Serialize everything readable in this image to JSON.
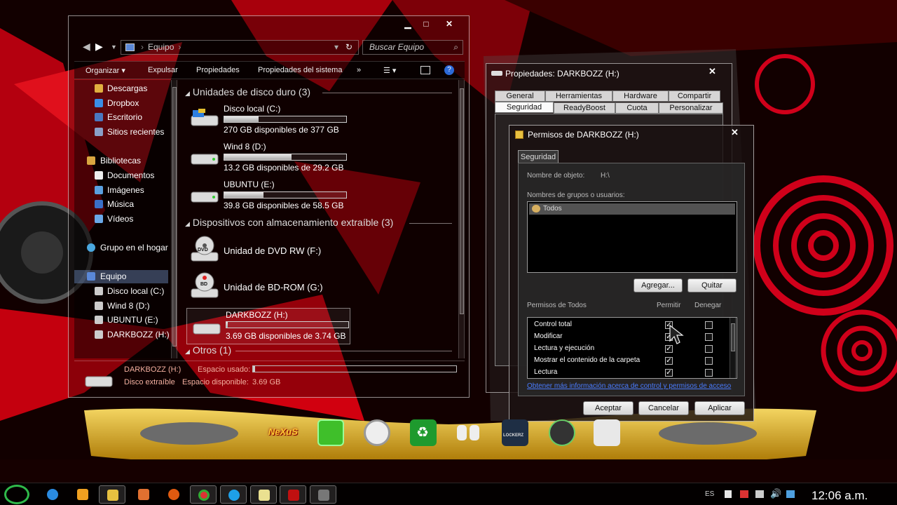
{
  "explorer": {
    "address_text": "Equipo",
    "search_placeholder": "Buscar Equipo",
    "toolbar": {
      "organize": "Organizar",
      "eject": "Expulsar",
      "properties": "Propiedades",
      "system_properties": "Propiedades del sistema",
      "more": "»"
    },
    "nav": {
      "favorites": [
        "Descargas",
        "Dropbox",
        "Escritorio",
        "Sitios recientes"
      ],
      "libraries_header": "Bibliotecas",
      "libraries": [
        "Documentos",
        "Imágenes",
        "Música",
        "Vídeos"
      ],
      "homegroup": "Grupo en el hogar",
      "computer": "Equipo",
      "drives": [
        "Disco local (C:)",
        "Wind 8 (D:)",
        "UBUNTU (E:)",
        "DARKBOZZ (H:)"
      ]
    },
    "groups": {
      "hard_disks": "Unidades de disco duro (3)",
      "removable": "Dispositivos con almacenamiento extraíble (3)",
      "other": "Otros (1)"
    },
    "hard_disks": [
      {
        "name": "Disco local (C:)",
        "free": "270 GB disponibles de 377 GB",
        "used_fraction": 0.28
      },
      {
        "name": "Wind 8 (D:)",
        "free": "13.2 GB disponibles de 29.2 GB",
        "used_fraction": 0.55
      },
      {
        "name": "UBUNTU (E:)",
        "free": "39.8 GB disponibles de 58.5 GB",
        "used_fraction": 0.32
      }
    ],
    "removable": [
      {
        "name": "Unidad de DVD RW (F:)",
        "icon_text": "DVD"
      },
      {
        "name": "Unidad de BD-ROM (G:)",
        "icon_text": "BD"
      },
      {
        "name": "DARKBOZZ (H:)",
        "free": "3.69 GB disponibles de 3.74 GB",
        "used_fraction": 0.01
      }
    ],
    "details": {
      "name": "DARKBOZZ (H:)",
      "type": "Disco extraíble",
      "used_label": "Espacio usado:",
      "free_label": "Espacio disponible:",
      "free_value": "3.69 GB"
    }
  },
  "properties": {
    "title": "Propiedades: DARKBOZZ (H:)",
    "tabs_row1": [
      "General",
      "Herramientas",
      "Hardware",
      "Compartir"
    ],
    "tabs_row2": [
      "Seguridad",
      "ReadyBoost",
      "Cuota",
      "Personalizar"
    ]
  },
  "permissions": {
    "title": "Permisos de DARKBOZZ (H:)",
    "tab": "Seguridad",
    "object_label": "Nombre de objeto:",
    "object_value": "H:\\",
    "groups_label": "Nombres de grupos o usuarios:",
    "users": [
      "Todos"
    ],
    "add_button": "Agregar...",
    "remove_button": "Quitar",
    "perms_header": "Permisos de Todos",
    "allow_header": "Permitir",
    "deny_header": "Denegar",
    "perms": [
      {
        "name": "Control total",
        "allow": true,
        "deny": false
      },
      {
        "name": "Modificar",
        "allow": true,
        "deny": false
      },
      {
        "name": "Lectura y ejecución",
        "allow": true,
        "deny": false
      },
      {
        "name": "Mostrar el contenido de la carpeta",
        "allow": true,
        "deny": false
      },
      {
        "name": "Lectura",
        "allow": true,
        "deny": false
      }
    ],
    "info_link": "Obtener más información acerca de control y permisos de acceso",
    "ok_button": "Aceptar",
    "cancel_button": "Cancelar",
    "apply_button": "Aplicar"
  },
  "dock": {
    "nexus_text": "NeXuS",
    "lockerz_text": "LOCKERZ"
  },
  "taskbar": {
    "language": "ES",
    "clock": "12:06 a.m."
  },
  "colors": {
    "accent_red": "#d0001a",
    "link_blue": "#4a7cff"
  }
}
